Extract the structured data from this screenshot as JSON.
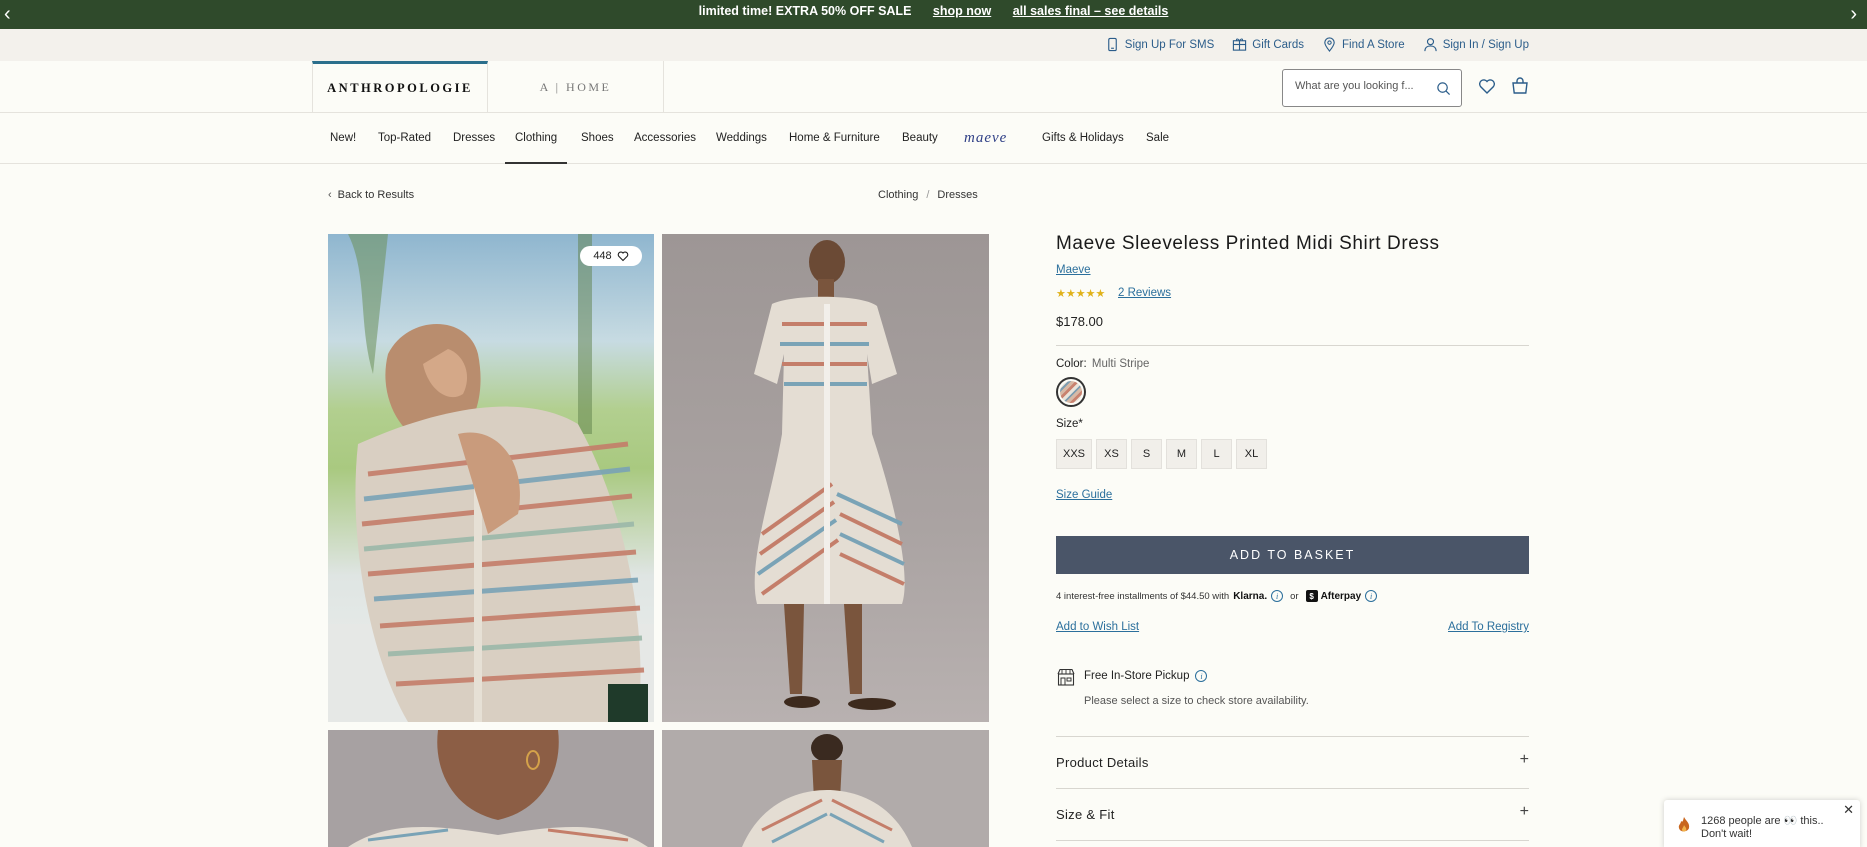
{
  "promo": {
    "message": "limited time! EXTRA 50% OFF SALE",
    "shop_now": "shop now",
    "sales_final": "all sales final – see details",
    "prev": "‹",
    "next": "›"
  },
  "utility": {
    "sms": "Sign Up For SMS",
    "gift_cards": "Gift Cards",
    "find_store": "Find A Store",
    "sign_in": "Sign In / Sign Up"
  },
  "header": {
    "brand": "ANTHROPOLOGIE",
    "home_brand": "A | HOME",
    "search_placeholder": "What are you looking f..."
  },
  "nav": {
    "items": [
      {
        "label": "New!"
      },
      {
        "label": "Top-Rated"
      },
      {
        "label": "Dresses"
      },
      {
        "label": "Clothing"
      },
      {
        "label": "Shoes"
      },
      {
        "label": "Accessories"
      },
      {
        "label": "Weddings"
      },
      {
        "label": "Home & Furniture"
      },
      {
        "label": "Beauty"
      },
      {
        "label": "maeve"
      },
      {
        "label": "Gifts & Holidays"
      },
      {
        "label": "Sale"
      }
    ],
    "active": "Clothing"
  },
  "breadcrumb": {
    "back": "Back to Results",
    "items": [
      "Clothing",
      "Dresses"
    ],
    "sep": "/"
  },
  "gallery": {
    "favorites_count": "448"
  },
  "product": {
    "title": "Maeve Sleeveless Printed Midi Shirt Dress",
    "brand": "Maeve",
    "stars": "★★★★★",
    "rating": 5,
    "reviews": "2 Reviews",
    "price": "$178.00",
    "color_label": "Color:",
    "color_value": "Multi Stripe",
    "size_label": "Size*",
    "sizes": [
      "XXS",
      "XS",
      "S",
      "M",
      "L",
      "XL"
    ],
    "size_guide": "Size Guide",
    "add_to_basket": "ADD TO BASKET",
    "installments_text": "4 interest-free installments of $44.50 with",
    "klarna": "Klarna.",
    "or": "or",
    "afterpay": "Afterpay",
    "add_to_wishlist": "Add to Wish List",
    "add_to_registry": "Add To Registry",
    "pickup_title": "Free In-Store Pickup",
    "pickup_sub": "Please select a size to check store availability.",
    "accordions": [
      "Product Details",
      "Size & Fit"
    ],
    "plus": "+"
  },
  "toast": {
    "line1": "1268 people are 👀 this..",
    "line2": "Don't wait!",
    "close": "✕"
  },
  "colors": {
    "promo_bg": "#2f4a2b",
    "link": "#2b6f9c",
    "basket_bg": "#4a5568",
    "star": "#e0b21a"
  }
}
